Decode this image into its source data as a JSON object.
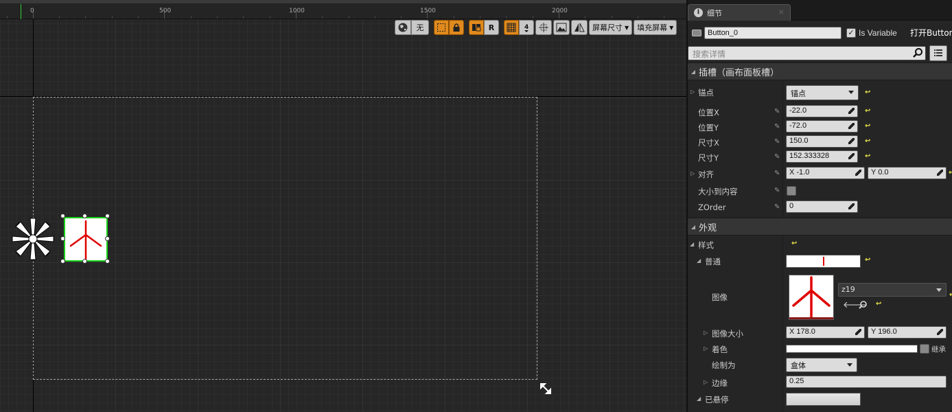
{
  "ruler": {
    "labels": [
      "0",
      "500",
      "1000",
      "1500",
      "2000"
    ]
  },
  "toolbar": {
    "none_label": "无",
    "r_label": "R",
    "screen_size_label": "屏幕尺寸",
    "fill_screen_label": "填充屏幕"
  },
  "details": {
    "tab_title": "细节",
    "tab_close": "×",
    "widget_name": "Button_0",
    "is_variable_label": "Is Variable",
    "open_label": "打开Button",
    "search_placeholder": "搜索详情",
    "section_slot": "插槽（画布面板槽）",
    "section_appearance": "外观",
    "anchors_label": "锚点",
    "anchors_value": "锚点",
    "pos_x_label": "位置X",
    "pos_x_value": "-22.0",
    "pos_y_label": "位置Y",
    "pos_y_value": "-72.0",
    "size_x_label": "尺寸X",
    "size_x_value": "150.0",
    "size_y_label": "尺寸Y",
    "size_y_value": "152.333328",
    "alignment_label": "对齐",
    "alignment_x": "X  -1.0",
    "alignment_y": "Y  0.0",
    "size_to_content_label": "大小到内容",
    "zorder_label": "ZOrder",
    "zorder_value": "0",
    "style_label": "样式",
    "normal_label": "普通",
    "image_label": "图像",
    "image_asset": "z19",
    "image_size_label": "图像大小",
    "image_size_x": "X  178.0",
    "image_size_y": "Y  196.0",
    "tint_label": "着色",
    "inherit_label": "继承",
    "draw_as_label": "绘制为",
    "draw_as_value": "盒体",
    "margin_label": "边缘",
    "margin_value": "0.25",
    "hovered_label": "已悬停"
  },
  "colors": {
    "accent_orange": "#e08a1e",
    "selection_green": "#19d119",
    "glyph_red": "#e00000",
    "reset_yellow": "#e8e24a"
  }
}
